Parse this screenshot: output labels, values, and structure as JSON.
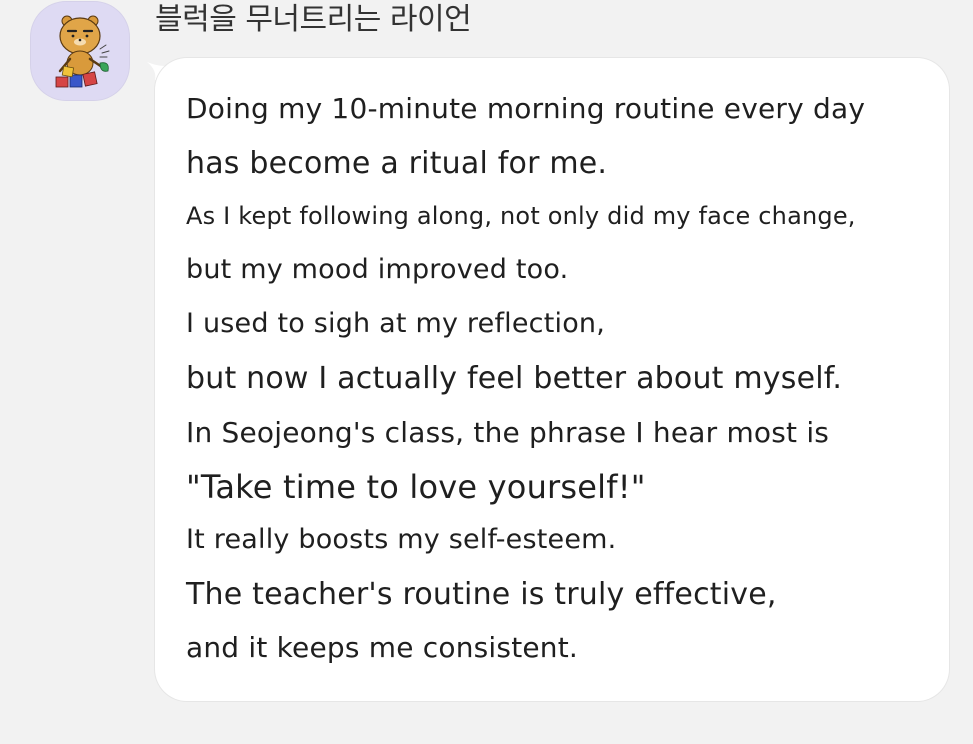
{
  "sender": {
    "name": "블럭을 무너트리는 라이언"
  },
  "avatar": {
    "icon": "ryan-lion-character-icon"
  },
  "message": {
    "lines": [
      "Doing my 10-minute morning routine every day",
      "has become a ritual for me.",
      "As I kept following along, not only did my face change,",
      "but my mood improved too.",
      "I used to sigh at my reflection,",
      "but now I actually feel better about myself.",
      "In Seojeong's class, the phrase I hear most is",
      "\"Take time to love yourself!\"",
      "It really boosts my self-esteem.",
      "The teacher's routine is truly effective,",
      "and it keeps me consistent."
    ]
  },
  "colors": {
    "background": "#f2f2f2",
    "bubble": "#ffffff",
    "avatar_bg": "#dedaf3",
    "text": "#1f1f1f"
  }
}
